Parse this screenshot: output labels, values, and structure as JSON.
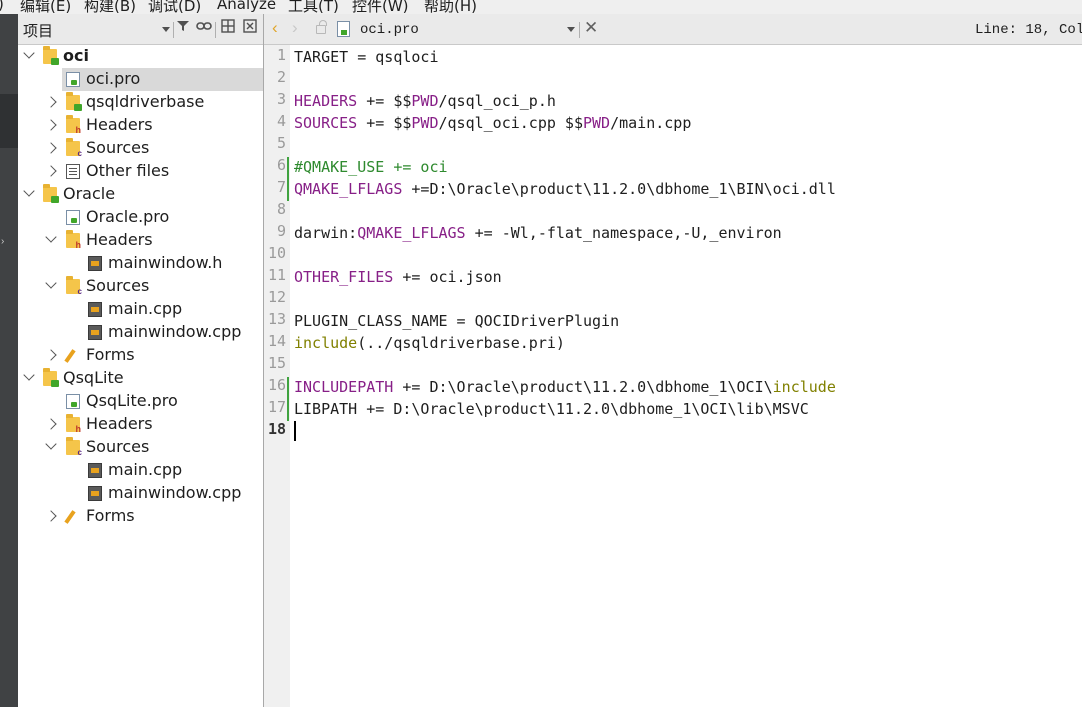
{
  "menubar": {
    "items": [
      ")",
      "编辑(E)",
      "构建(B)",
      "调试(D)",
      "Analyze",
      "工具(T)",
      "控件(W)",
      "帮助(H)"
    ]
  },
  "project_panel": {
    "combo_label": "项目",
    "tree": [
      {
        "label": "oci",
        "bold": true,
        "icon": "project-folder-icon",
        "expanded": true
      },
      {
        "label": "oci.pro",
        "icon": "pro-file-icon",
        "selected": true
      },
      {
        "label": "qsqldriverbase",
        "icon": "project-folder-icon",
        "expanded": false
      },
      {
        "label": "Headers",
        "icon": "headers-folder-icon",
        "expanded": false
      },
      {
        "label": "Sources",
        "icon": "sources-folder-icon",
        "expanded": false
      },
      {
        "label": "Other files",
        "icon": "other-files-icon",
        "expanded": false
      },
      {
        "label": "Oracle",
        "icon": "project-folder-icon",
        "expanded": true
      },
      {
        "label": "Oracle.pro",
        "icon": "pro-file-icon"
      },
      {
        "label": "Headers",
        "icon": "headers-folder-icon",
        "expanded": true
      },
      {
        "label": "mainwindow.h",
        "icon": "source-file-icon"
      },
      {
        "label": "Sources",
        "icon": "sources-folder-icon",
        "expanded": true
      },
      {
        "label": "main.cpp",
        "icon": "source-file-icon"
      },
      {
        "label": "mainwindow.cpp",
        "icon": "source-file-icon"
      },
      {
        "label": "Forms",
        "icon": "forms-folder-icon",
        "expanded": false
      },
      {
        "label": "QsqLite",
        "icon": "project-folder-icon",
        "expanded": true
      },
      {
        "label": "QsqLite.pro",
        "icon": "pro-file-icon"
      },
      {
        "label": "Headers",
        "icon": "headers-folder-icon",
        "expanded": false
      },
      {
        "label": "Sources",
        "icon": "sources-folder-icon",
        "expanded": true
      },
      {
        "label": "main.cpp",
        "icon": "source-file-icon"
      },
      {
        "label": "mainwindow.cpp",
        "icon": "source-file-icon"
      },
      {
        "label": "Forms",
        "icon": "forms-folder-icon",
        "expanded": false
      }
    ]
  },
  "editor": {
    "file_name": "oci.pro",
    "cursor_position": "Line: 18, Col",
    "current_line": 18,
    "changed_lines": [
      6,
      7,
      16,
      17
    ],
    "lines": [
      [
        {
          "t": "TARGET = qsqloci",
          "c": ""
        }
      ],
      [],
      [
        {
          "t": "HEADERS",
          "c": "kw"
        },
        {
          "t": " += $$",
          "c": ""
        },
        {
          "t": "PWD",
          "c": "kw"
        },
        {
          "t": "/qsql_oci_p.h",
          "c": ""
        }
      ],
      [
        {
          "t": "SOURCES",
          "c": "kw"
        },
        {
          "t": " += $$",
          "c": ""
        },
        {
          "t": "PWD",
          "c": "kw"
        },
        {
          "t": "/qsql_oci.cpp $$",
          "c": ""
        },
        {
          "t": "PWD",
          "c": "kw"
        },
        {
          "t": "/main.cpp",
          "c": ""
        }
      ],
      [],
      [
        {
          "t": "#QMAKE_USE += oci",
          "c": "cm"
        }
      ],
      [
        {
          "t": "QMAKE_LFLAGS",
          "c": "kw"
        },
        {
          "t": " +=D:\\Oracle\\product\\11.2.0\\dbhome_1\\BIN\\oci.dll",
          "c": ""
        }
      ],
      [],
      [
        {
          "t": "darwin:",
          "c": ""
        },
        {
          "t": "QMAKE_LFLAGS",
          "c": "kw"
        },
        {
          "t": " += -Wl,-flat_namespace,-U,_environ",
          "c": ""
        }
      ],
      [],
      [
        {
          "t": "OTHER_FILES",
          "c": "kw"
        },
        {
          "t": " += oci.json",
          "c": ""
        }
      ],
      [],
      [
        {
          "t": "PLUGIN_CLASS_NAME = QOCIDriverPlugin",
          "c": ""
        }
      ],
      [
        {
          "t": "include",
          "c": "fn"
        },
        {
          "t": "(../qsqldriverbase.pri)",
          "c": ""
        }
      ],
      [],
      [
        {
          "t": "INCLUDEPATH",
          "c": "kw"
        },
        {
          "t": " += D:\\Oracle\\product\\11.2.0\\dbhome_1\\OCI\\",
          "c": ""
        },
        {
          "t": "include",
          "c": "fn"
        }
      ],
      [
        {
          "t": "LIBPATH += D:\\Oracle\\product\\11.2.0\\dbhome_1\\OCI\\lib\\MSVC",
          "c": ""
        }
      ],
      []
    ]
  }
}
